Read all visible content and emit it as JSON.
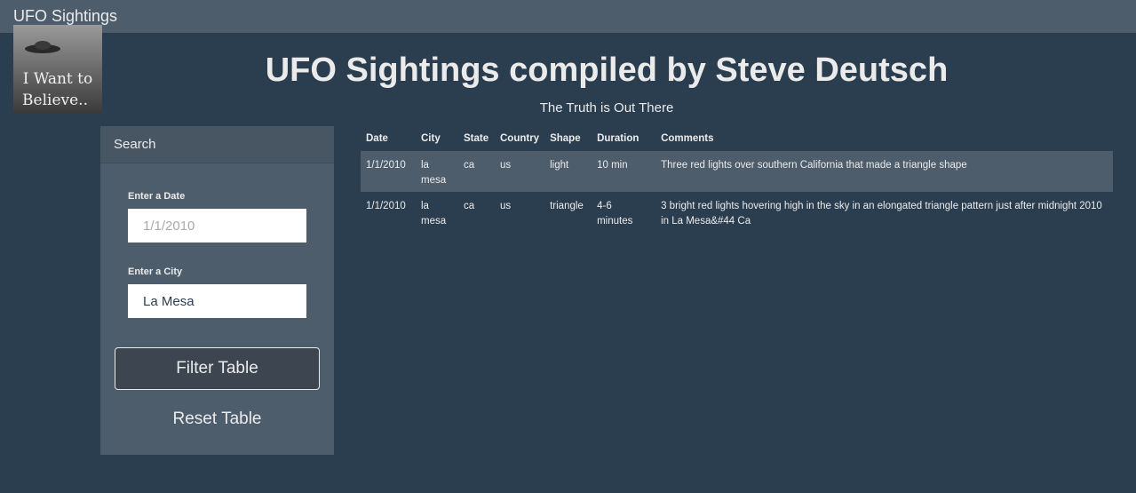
{
  "navbar": {
    "brand": "UFO Sightings"
  },
  "logo": {
    "line1": "I Want to",
    "line2": "Believe.."
  },
  "hero": {
    "title": "UFO Sightings compiled by Steve Deutsch",
    "subtitle": "The Truth is Out There"
  },
  "search": {
    "heading": "Search",
    "date_label": "Enter a Date",
    "date_placeholder": "1/1/2010",
    "date_value": "",
    "city_label": "Enter a City",
    "city_value": "La Mesa",
    "filter_label": "Filter Table",
    "reset_label": "Reset Table"
  },
  "table": {
    "headers": [
      "Date",
      "City",
      "State",
      "Country",
      "Shape",
      "Duration",
      "Comments"
    ],
    "rows": [
      [
        "1/1/2010",
        "la mesa",
        "ca",
        "us",
        "light",
        "10 min",
        "Three red lights over southern California that made a triangle shape"
      ],
      [
        "1/1/2010",
        "la mesa",
        "ca",
        "us",
        "triangle",
        "4-6 minutes",
        "3 bright red lights hovering high in the sky in an elongated triangle pattern just after midnight 2010 in La Mesa&#44 Ca"
      ]
    ]
  }
}
